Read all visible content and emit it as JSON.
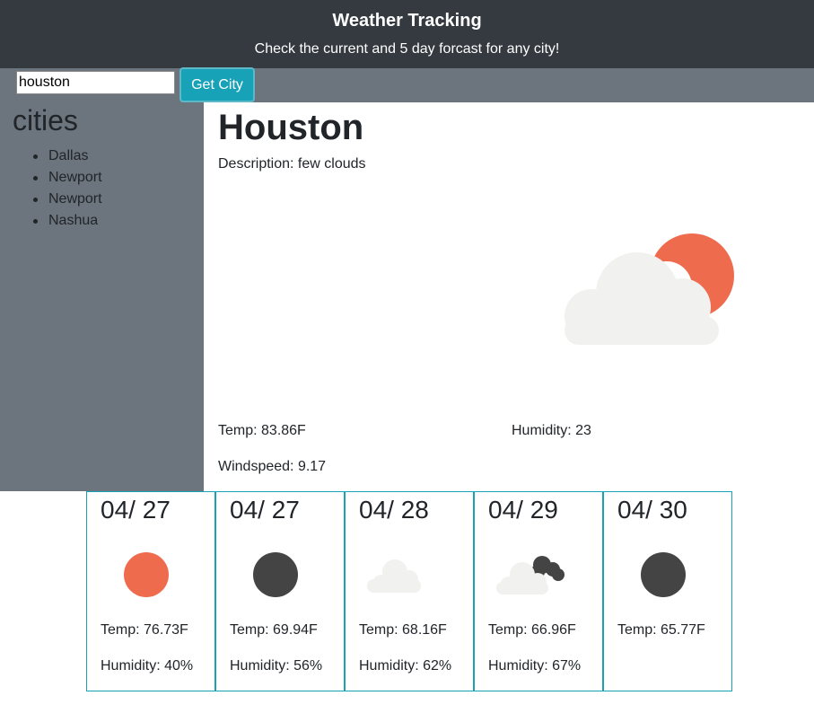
{
  "header": {
    "title": "Weather Tracking",
    "subtitle": "Check the current and 5 day forcast for any city!"
  },
  "search": {
    "value": "houston",
    "button_label": "Get City"
  },
  "sidebar": {
    "heading": "cities",
    "items": [
      "Dallas",
      "Newport",
      "Newport",
      "Nashua"
    ]
  },
  "current": {
    "city": "Houston",
    "description": "Description: few clouds",
    "temp": "Temp: 83.86F",
    "humidity": "Humidity: 23",
    "windspeed": "Windspeed: 9.17",
    "icon": "few-clouds-day-icon"
  },
  "forecast": [
    {
      "date": "04/ 27",
      "temp": "Temp: 76.73F",
      "humidity": "Humidity: 40%",
      "icon": "sun-icon"
    },
    {
      "date": "04/ 27",
      "temp": "Temp: 69.94F",
      "humidity": "Humidity: 56%",
      "icon": "moon-icon"
    },
    {
      "date": "04/ 28",
      "temp": "Temp: 68.16F",
      "humidity": "Humidity: 62%",
      "icon": "cloud-icon"
    },
    {
      "date": "04/ 29",
      "temp": "Temp: 66.96F",
      "humidity": "Humidity: 67%",
      "icon": "cloud-night-icon"
    },
    {
      "date": "04/ 30",
      "temp": "Temp: 65.77F",
      "humidity": "",
      "icon": "moon-icon"
    }
  ],
  "colors": {
    "header_bg": "#343a40",
    "sidebar_bg": "#6c757d",
    "accent": "#17a2b8",
    "sun": "#ee6c4d",
    "moon": "#444444",
    "cloud": "#f1f1ef"
  }
}
